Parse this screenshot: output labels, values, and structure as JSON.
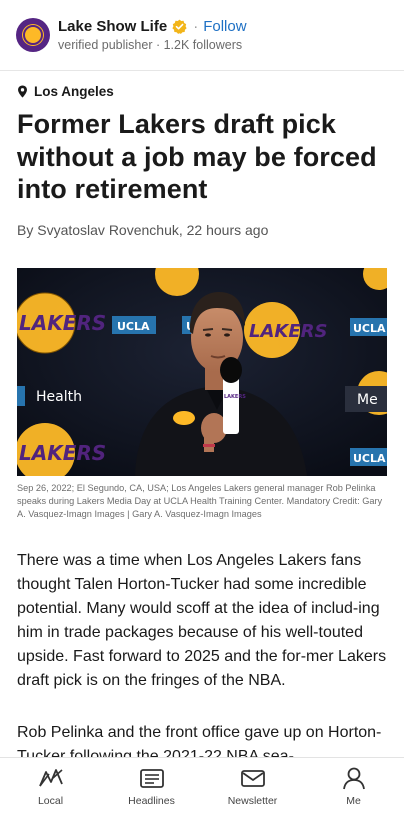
{
  "publisher": {
    "name": "Lake Show Life",
    "follow_label": "Follow",
    "subtitle": "verified publisher · 1.2K followers",
    "dot": "·"
  },
  "article": {
    "location": "Los Angeles",
    "title": "Former Lakers draft pick without a job may be forced into retirement",
    "byline": "By Svyatoslav Rovenchuk, 22 hours ago",
    "caption": "Sep 26, 2022; El Segundo, CA, USA; Los Angeles Lakers general manager Rob Pelinka speaks during Lakers Media Day at UCLA Health Training Center. Mandatory Credit: Gary A. Vasquez-Imagn Images | Gary A. Vasquez-Imagn Images",
    "paragraphs": [
      "There was a time when Los Angeles Lakers fans thought Talen Horton-Tucker had some incredible potential. Many would scoff at the idea of includ-ing him in trade packages because of his well-touted upside. Fast forward to 2025 and the for-mer Lakers draft pick is on the fringes of the NBA.",
      "Rob Pelinka and the front office gave up on Horton-Tucker following the 2021-22 NBA sea-"
    ]
  },
  "hero_image": {
    "backdrop_text_1": "LAKERS",
    "backdrop_text_2": "UCLA",
    "backdrop_text_3": "Health",
    "backdrop_text_4": "Me",
    "mic_text": "LAKERS"
  },
  "nav": [
    {
      "label": "Local",
      "icon": "local-map-icon"
    },
    {
      "label": "Headlines",
      "icon": "headlines-icon"
    },
    {
      "label": "Newsletter",
      "icon": "newsletter-icon"
    },
    {
      "label": "Me",
      "icon": "profile-icon"
    }
  ],
  "colors": {
    "accent_blue": "#1e70c4",
    "lakers_purple": "#552583",
    "lakers_gold": "#fdb927",
    "ucla_blue": "#2774ae"
  }
}
